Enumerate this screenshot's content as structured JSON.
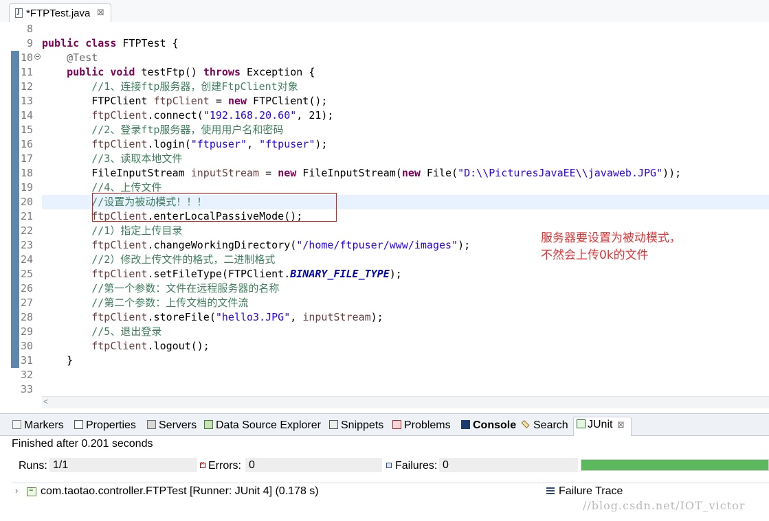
{
  "editor_tab": {
    "label": "*FTPTest.java",
    "close": "⊠"
  },
  "code": {
    "line_numbers": [
      "8",
      "9",
      "10",
      "11",
      "12",
      "13",
      "14",
      "15",
      "16",
      "17",
      "18",
      "19",
      "20",
      "21",
      "22",
      "23",
      "24",
      "25",
      "26",
      "27",
      "28",
      "29",
      "30",
      "31",
      "32",
      "33"
    ],
    "lines": [
      [],
      [
        [
          "kw",
          "public"
        ],
        [
          "p",
          " "
        ],
        [
          "kw",
          "class"
        ],
        [
          "p",
          " FTPTest {"
        ]
      ],
      [
        [
          "p",
          "    "
        ],
        [
          "ann",
          "@Test"
        ]
      ],
      [
        [
          "p",
          "    "
        ],
        [
          "kw",
          "public"
        ],
        [
          "p",
          " "
        ],
        [
          "kw",
          "void"
        ],
        [
          "p",
          " testFtp() "
        ],
        [
          "kw",
          "throws"
        ],
        [
          "p",
          " Exception {"
        ]
      ],
      [
        [
          "p",
          "        "
        ],
        [
          "cm",
          "//1、连接ftp服务器，创建FtpClient对象"
        ]
      ],
      [
        [
          "p",
          "        FTPClient "
        ],
        [
          "var",
          "ftpClient"
        ],
        [
          "p",
          " = "
        ],
        [
          "kw",
          "new"
        ],
        [
          "p",
          " FTPClient();"
        ]
      ],
      [
        [
          "p",
          "        "
        ],
        [
          "var",
          "ftpClient"
        ],
        [
          "p",
          ".connect("
        ],
        [
          "str",
          "\"192.168.20.60\""
        ],
        [
          "p",
          ", 21);"
        ]
      ],
      [
        [
          "p",
          "        "
        ],
        [
          "cm",
          "//2、登录ftp服务器，使用用户名和密码"
        ]
      ],
      [
        [
          "p",
          "        "
        ],
        [
          "var",
          "ftpClient"
        ],
        [
          "p",
          ".login("
        ],
        [
          "str",
          "\"ftpuser\""
        ],
        [
          "p",
          ", "
        ],
        [
          "str",
          "\"ftpuser\""
        ],
        [
          "p",
          ");"
        ]
      ],
      [
        [
          "p",
          "        "
        ],
        [
          "cm",
          "//3、读取本地文件"
        ]
      ],
      [
        [
          "p",
          "        FileInputStream "
        ],
        [
          "var",
          "inputStream"
        ],
        [
          "p",
          " = "
        ],
        [
          "kw",
          "new"
        ],
        [
          "p",
          " FileInputStream("
        ],
        [
          "kw",
          "new"
        ],
        [
          "p",
          " File("
        ],
        [
          "str",
          "\"D:\\\\PicturesJavaEE\\\\javaweb.JPG\""
        ],
        [
          "p",
          "));"
        ]
      ],
      [
        [
          "p",
          "        "
        ],
        [
          "cm",
          "//4、上传文件"
        ]
      ],
      [
        [
          "p",
          "        "
        ],
        [
          "cm",
          "//设置为被动模式！！！"
        ]
      ],
      [
        [
          "p",
          "        "
        ],
        [
          "var",
          "ftpClient"
        ],
        [
          "p",
          ".enterLocalPassiveMode();"
        ]
      ],
      [
        [
          "p",
          "        "
        ],
        [
          "cm",
          "//1）指定上传目录"
        ]
      ],
      [
        [
          "p",
          "        "
        ],
        [
          "var",
          "ftpClient"
        ],
        [
          "p",
          ".changeWorkingDirectory("
        ],
        [
          "str",
          "\"/home/ftpuser/www/images\""
        ],
        [
          "p",
          ");"
        ]
      ],
      [
        [
          "p",
          "        "
        ],
        [
          "cm",
          "//2）修改上传文件的格式，二进制格式"
        ]
      ],
      [
        [
          "p",
          "        "
        ],
        [
          "var",
          "ftpClient"
        ],
        [
          "p",
          ".setFileType(FTPClient."
        ],
        [
          "st",
          "BINARY_FILE_TYPE"
        ],
        [
          "p",
          ");"
        ]
      ],
      [
        [
          "p",
          "        "
        ],
        [
          "cm",
          "//第一个参数：文件在远程服务器的名称"
        ]
      ],
      [
        [
          "p",
          "        "
        ],
        [
          "cm",
          "//第二个参数：上传文档的文件流"
        ]
      ],
      [
        [
          "p",
          "        "
        ],
        [
          "var",
          "ftpClient"
        ],
        [
          "p",
          ".storeFile("
        ],
        [
          "str",
          "\"hello3.JPG\""
        ],
        [
          "p",
          ", "
        ],
        [
          "var",
          "inputStream"
        ],
        [
          "p",
          ");"
        ]
      ],
      [
        [
          "p",
          "        "
        ],
        [
          "cm",
          "//5、退出登录"
        ]
      ],
      [
        [
          "p",
          "        "
        ],
        [
          "var",
          "ftpClient"
        ],
        [
          "p",
          ".logout();"
        ]
      ],
      [
        [
          "p",
          "    }"
        ]
      ],
      [],
      []
    ],
    "highlight_line": "20",
    "fold_line": "10",
    "gutter_marked_lines": [
      "10",
      "11",
      "12",
      "13",
      "14",
      "15",
      "16",
      "17",
      "18",
      "19",
      "20",
      "21",
      "22",
      "23",
      "24",
      "25",
      "26",
      "27",
      "28",
      "29",
      "30",
      "31"
    ]
  },
  "annotation_note": "服务器要设置为被动模式，\n不然会上传0k的文件",
  "views": {
    "tabs": [
      {
        "id": "markers",
        "label": "Markers",
        "icon": "markers-icon"
      },
      {
        "id": "properties",
        "label": "Properties",
        "icon": "properties-icon"
      },
      {
        "id": "servers",
        "label": "Servers",
        "icon": "servers-icon"
      },
      {
        "id": "data-source-explorer",
        "label": "Data Source Explorer",
        "icon": "data-source-icon"
      },
      {
        "id": "snippets",
        "label": "Snippets",
        "icon": "snippets-icon"
      },
      {
        "id": "problems",
        "label": "Problems",
        "icon": "problems-icon"
      },
      {
        "id": "console",
        "label": "Console",
        "icon": "console-icon"
      },
      {
        "id": "search",
        "label": "Search",
        "icon": "search-icon"
      },
      {
        "id": "junit",
        "label": "JUnit",
        "icon": "junit-icon",
        "close": "⊠"
      }
    ],
    "junit": {
      "finished": "Finished after 0.201 seconds",
      "runs_label": "Runs:",
      "runs_value": "1/1",
      "errors_label": "Errors:",
      "errors_value": "0",
      "failures_label": "Failures:",
      "failures_value": "0",
      "progress": 1.0,
      "progress_color": "#5cb85c",
      "tree_item": "com.taotao.controller.FTPTest [Runner: JUnit 4] (0.178 s)",
      "failure_trace": "Failure Trace"
    }
  },
  "watermark": "//blog.csdn.net/IOT_victor",
  "colors": {
    "keyword": "#7f0055",
    "comment": "#3f7f5f",
    "string": "#2a00ff",
    "variable": "#6a3e3e",
    "note": "#e53333"
  }
}
